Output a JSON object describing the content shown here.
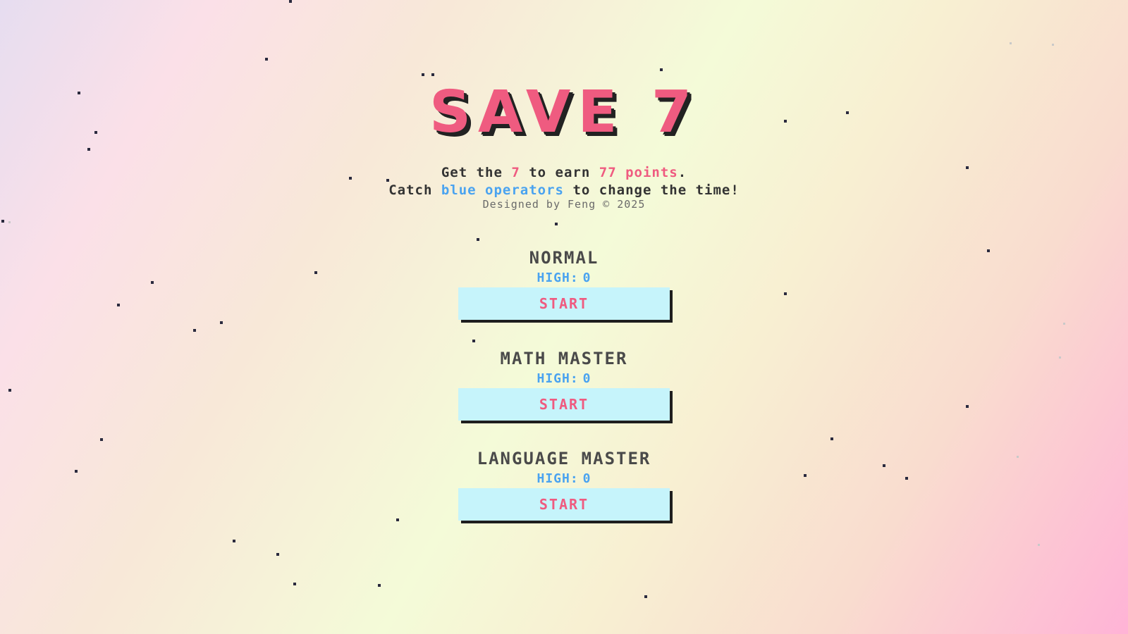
{
  "title": "SAVE 7",
  "instructions": {
    "line1_pre": "Get the ",
    "line1_seven": "7",
    "line1_mid": " to earn ",
    "line1_points": "77 points",
    "line1_end": ".",
    "line2_pre": "Catch ",
    "line2_blue": "blue operators",
    "line2_end": " to change the time!"
  },
  "credit": "Designed by Feng © 2025",
  "modes": [
    {
      "name": "NORMAL",
      "high_label": "HIGH:",
      "high_value": "0",
      "button": "START"
    },
    {
      "name": "MATH MASTER",
      "high_label": "HIGH:",
      "high_value": "0",
      "button": "START"
    },
    {
      "name": "LANGUAGE MASTER",
      "high_label": "HIGH:",
      "high_value": "0",
      "button": "START"
    }
  ],
  "colors": {
    "accent_pink": "#ef5b80",
    "accent_blue": "#4aa3f0",
    "button_bg": "#c6f4fb",
    "particle": "#2a2a3e"
  }
}
